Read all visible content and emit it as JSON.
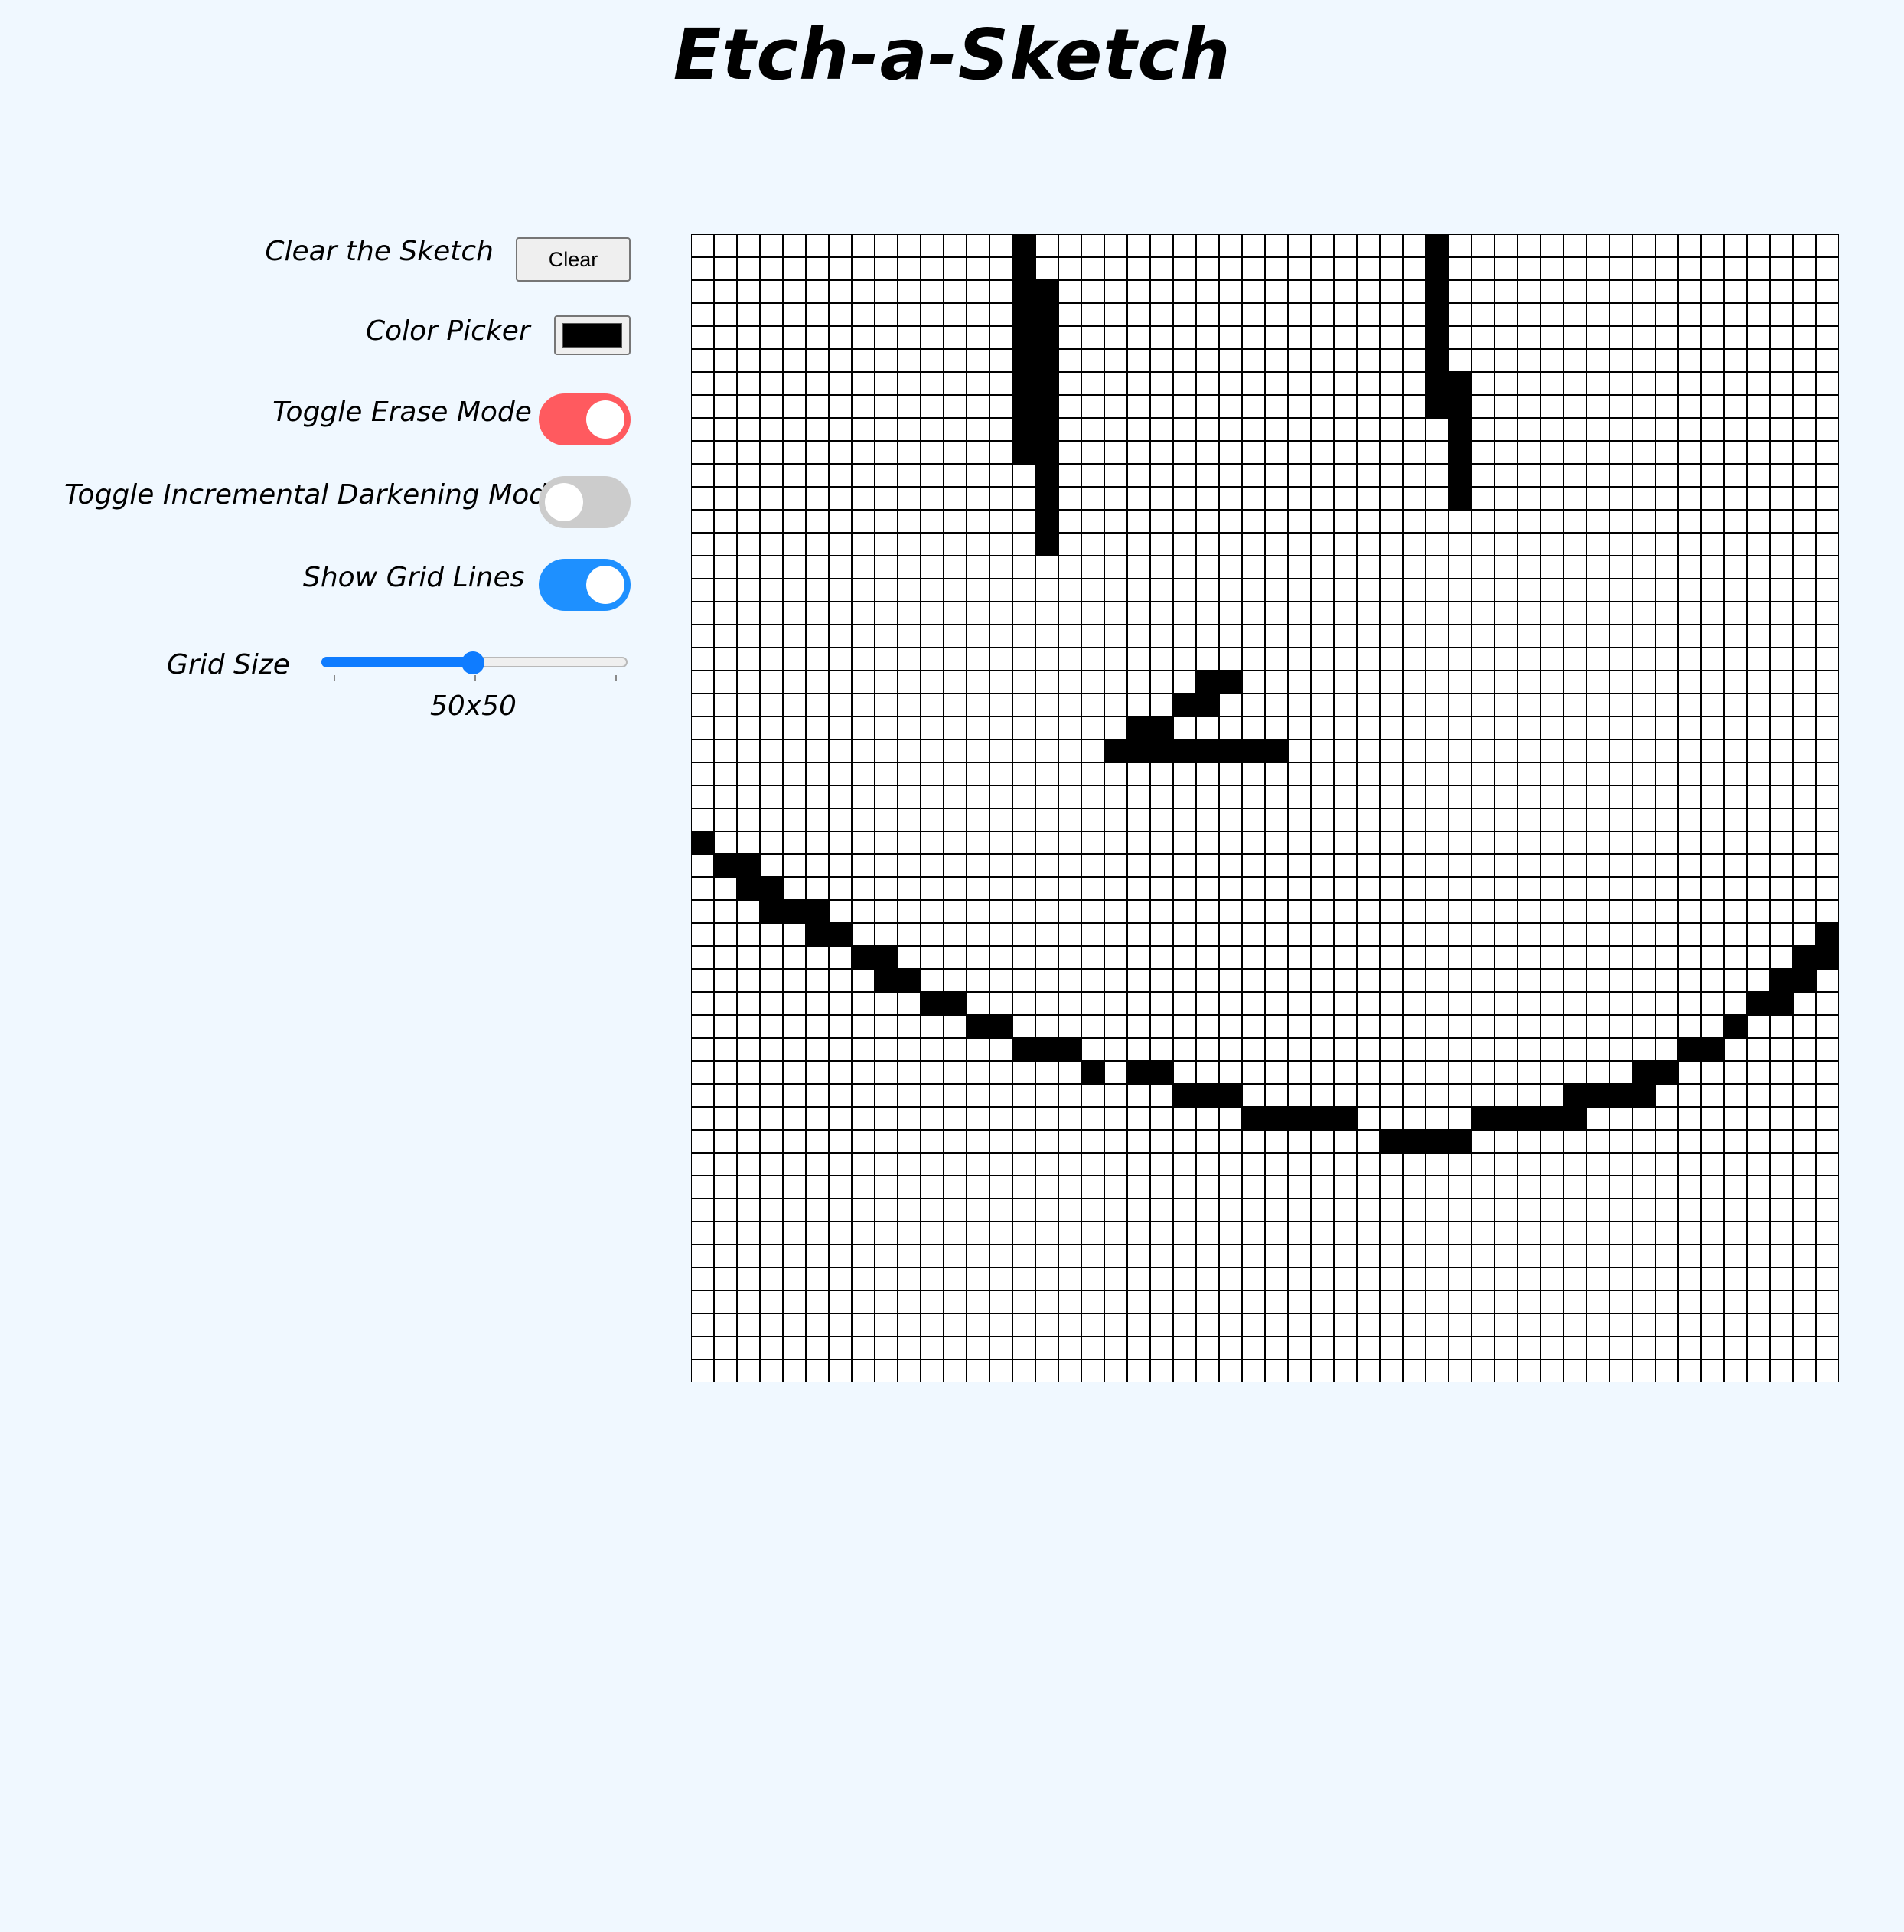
{
  "title": "Etch-a-Sketch",
  "controls": {
    "clear_label": "Clear the Sketch",
    "clear_button": "Clear",
    "color_label": "Color Picker",
    "color_value": "#000000",
    "erase_label": "Toggle Erase Mode",
    "erase_on": true,
    "erase_color": "#ff5a5f",
    "darken_label": "Toggle Incremental Darkening Mode",
    "darken_on": false,
    "darken_color": "#cccccc",
    "gridlines_label": "Show Grid Lines",
    "gridlines_on": true,
    "gridlines_color": "#1e90ff",
    "gridsize_label": "Grid Size",
    "gridsize_value": 50,
    "gridsize_min": 1,
    "gridsize_max": 100,
    "gridsize_text": "50x50"
  },
  "grid": {
    "size": 50,
    "ink": "#000000",
    "paper": "#ffffff",
    "filled": [
      [
        14,
        0
      ],
      [
        14,
        1
      ],
      [
        14,
        2
      ],
      [
        14,
        3
      ],
      [
        14,
        4
      ],
      [
        14,
        5
      ],
      [
        14,
        6
      ],
      [
        14,
        7
      ],
      [
        14,
        8
      ],
      [
        14,
        9
      ],
      [
        15,
        2
      ],
      [
        15,
        3
      ],
      [
        15,
        4
      ],
      [
        15,
        5
      ],
      [
        15,
        6
      ],
      [
        15,
        7
      ],
      [
        15,
        8
      ],
      [
        15,
        9
      ],
      [
        15,
        10
      ],
      [
        15,
        11
      ],
      [
        15,
        12
      ],
      [
        15,
        13
      ],
      [
        32,
        0
      ],
      [
        32,
        1
      ],
      [
        32,
        2
      ],
      [
        32,
        3
      ],
      [
        32,
        4
      ],
      [
        32,
        5
      ],
      [
        32,
        6
      ],
      [
        32,
        7
      ],
      [
        33,
        6
      ],
      [
        33,
        7
      ],
      [
        33,
        8
      ],
      [
        33,
        9
      ],
      [
        33,
        10
      ],
      [
        33,
        11
      ],
      [
        22,
        19
      ],
      [
        23,
        19
      ],
      [
        21,
        20
      ],
      [
        22,
        20
      ],
      [
        19,
        21
      ],
      [
        20,
        21
      ],
      [
        18,
        22
      ],
      [
        19,
        22
      ],
      [
        20,
        22
      ],
      [
        21,
        22
      ],
      [
        22,
        22
      ],
      [
        23,
        22
      ],
      [
        24,
        22
      ],
      [
        25,
        22
      ],
      [
        0,
        26
      ],
      [
        1,
        27
      ],
      [
        2,
        27
      ],
      [
        2,
        28
      ],
      [
        3,
        28
      ],
      [
        3,
        29
      ],
      [
        4,
        29
      ],
      [
        5,
        29
      ],
      [
        5,
        30
      ],
      [
        6,
        30
      ],
      [
        7,
        31
      ],
      [
        8,
        31
      ],
      [
        8,
        32
      ],
      [
        9,
        32
      ],
      [
        10,
        33
      ],
      [
        11,
        33
      ],
      [
        12,
        34
      ],
      [
        13,
        34
      ],
      [
        14,
        35
      ],
      [
        15,
        35
      ],
      [
        16,
        35
      ],
      [
        17,
        36
      ],
      [
        19,
        36
      ],
      [
        20,
        36
      ],
      [
        21,
        37
      ],
      [
        22,
        37
      ],
      [
        23,
        37
      ],
      [
        24,
        38
      ],
      [
        25,
        38
      ],
      [
        26,
        38
      ],
      [
        27,
        38
      ],
      [
        28,
        38
      ],
      [
        30,
        39
      ],
      [
        31,
        39
      ],
      [
        32,
        39
      ],
      [
        33,
        39
      ],
      [
        34,
        38
      ],
      [
        35,
        38
      ],
      [
        36,
        38
      ],
      [
        37,
        38
      ],
      [
        38,
        38
      ],
      [
        38,
        37
      ],
      [
        39,
        37
      ],
      [
        40,
        37
      ],
      [
        41,
        37
      ],
      [
        41,
        36
      ],
      [
        42,
        36
      ],
      [
        43,
        35
      ],
      [
        44,
        35
      ],
      [
        45,
        34
      ],
      [
        46,
        33
      ],
      [
        47,
        33
      ],
      [
        47,
        32
      ],
      [
        48,
        32
      ],
      [
        48,
        31
      ],
      [
        49,
        31
      ],
      [
        49,
        30
      ]
    ]
  }
}
